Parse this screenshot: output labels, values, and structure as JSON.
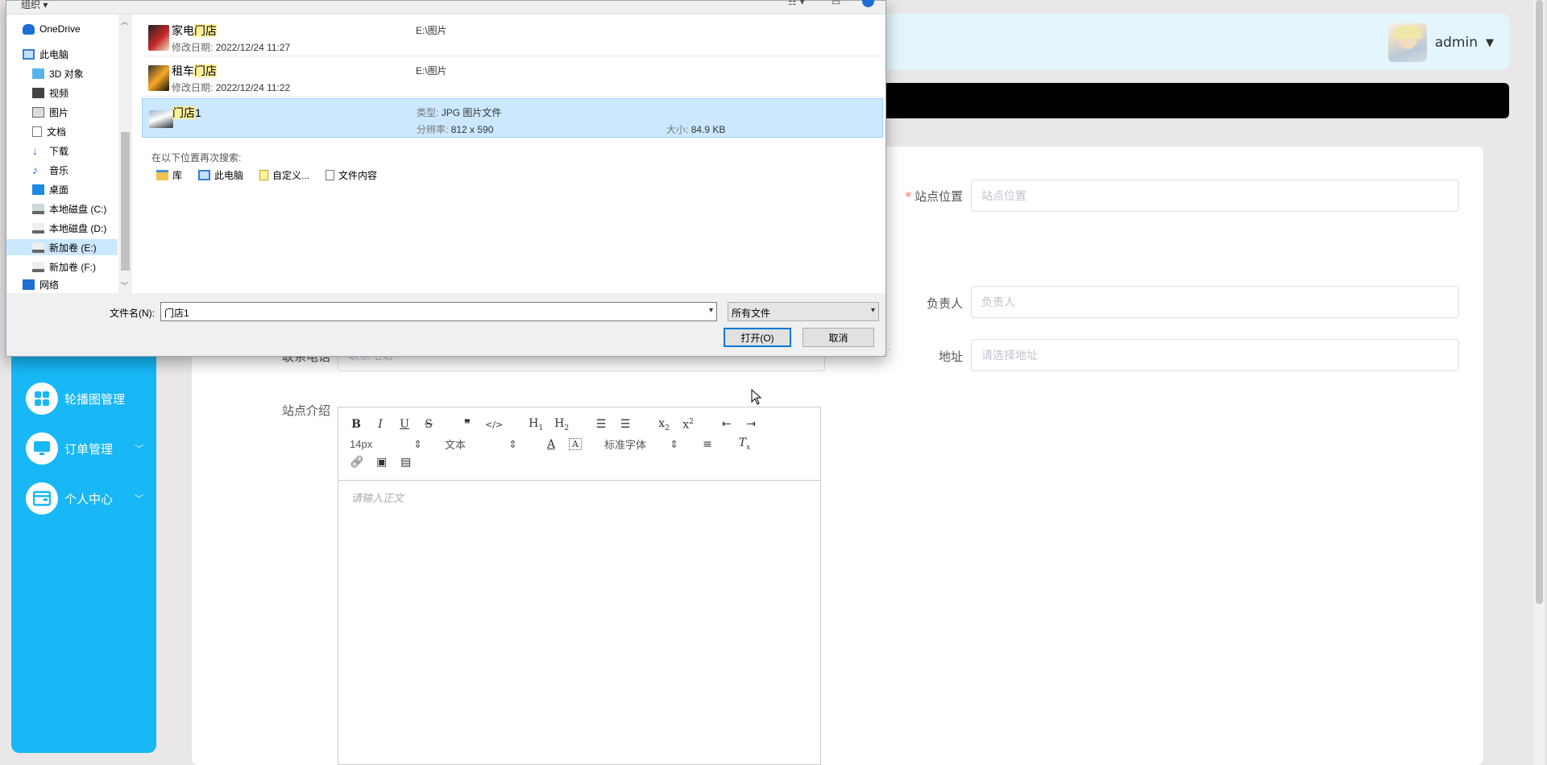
{
  "header": {
    "username": "admin",
    "dropdown_caret": "▼"
  },
  "sidebar": {
    "items": [
      {
        "label": "轮播图管理",
        "icon": "grid-icon",
        "has_submenu": false
      },
      {
        "label": "订单管理",
        "icon": "monitor-icon",
        "has_submenu": true
      },
      {
        "label": "个人中心",
        "icon": "wallet-icon",
        "has_submenu": true
      }
    ]
  },
  "form": {
    "site_location": {
      "label": "站点位置",
      "placeholder": "站点位置",
      "required": true
    },
    "manager": {
      "label": "负责人",
      "placeholder": "负责人"
    },
    "contact_phone": {
      "label": "联系电话",
      "placeholder": "联系电话"
    },
    "address": {
      "label": "地址",
      "placeholder": "请选择地址"
    },
    "intro": {
      "label": "站点介绍"
    }
  },
  "editor": {
    "font_size": "14px",
    "paragraph": "文本",
    "font_family": "标准字体",
    "placeholder": "请输入正文"
  },
  "dialog": {
    "toolbar_organize": "组织 ▾",
    "nav_items": [
      {
        "label": "OneDrive",
        "icon": "cloud-icon"
      },
      {
        "label": "此电脑",
        "icon": "computer-icon"
      },
      {
        "label": "3D 对象",
        "icon": "cube-icon"
      },
      {
        "label": "视频",
        "icon": "video-icon"
      },
      {
        "label": "图片",
        "icon": "picture-icon"
      },
      {
        "label": "文档",
        "icon": "document-icon"
      },
      {
        "label": "下载",
        "icon": "download-icon"
      },
      {
        "label": "音乐",
        "icon": "music-icon"
      },
      {
        "label": "桌面",
        "icon": "desktop-icon"
      },
      {
        "label": "本地磁盘 (C:)",
        "icon": "drive-icon"
      },
      {
        "label": "本地磁盘 (D:)",
        "icon": "drive-icon"
      },
      {
        "label": "新加卷 (E:)",
        "icon": "drive-icon",
        "selected": true
      },
      {
        "label": "新加卷 (F:)",
        "icon": "drive-icon"
      },
      {
        "label": "网络",
        "icon": "network-icon"
      }
    ],
    "files": [
      {
        "name_prefix": "家电",
        "name_match": "门店",
        "name_suffix": "",
        "date_label": "修改日期:",
        "date": "2022/12/24 11:27",
        "location": "E:\\图片"
      },
      {
        "name_prefix": "租车",
        "name_match": "门店",
        "name_suffix": "",
        "date_label": "修改日期:",
        "date": "2022/12/24 11:22",
        "location": "E:\\图片"
      },
      {
        "name_prefix": "",
        "name_match": "门店",
        "name_suffix": "1",
        "type_label": "类型:",
        "type": "JPG 图片文件",
        "res_label": "分辨率:",
        "resolution": "812 x 590",
        "size_label": "大小:",
        "size": "84.9 KB",
        "selected": true
      }
    ],
    "search_again": "在以下位置再次搜索:",
    "search_locations": [
      {
        "label": "库",
        "icon": "library-icon"
      },
      {
        "label": "此电脑",
        "icon": "computer-icon"
      },
      {
        "label": "自定义...",
        "icon": "custom-folder-icon"
      },
      {
        "label": "文件内容",
        "icon": "file-content-icon"
      }
    ],
    "filename_label": "文件名(N):",
    "filename_value": "门店1",
    "filetype_value": "所有文件",
    "open_button": "打开(O)",
    "cancel_button": "取消"
  }
}
